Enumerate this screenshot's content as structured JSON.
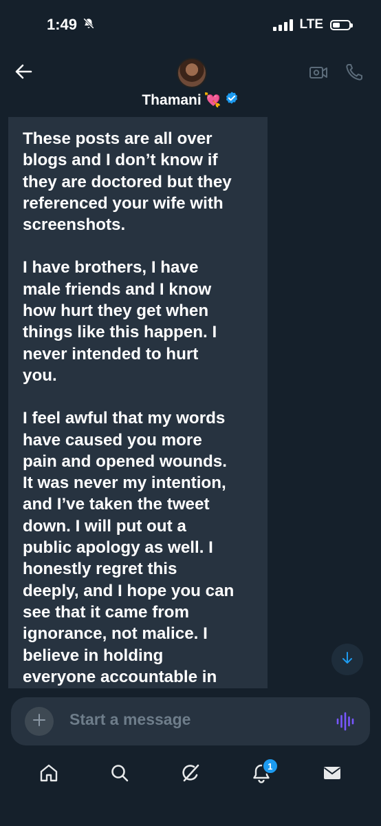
{
  "status_bar": {
    "time": "1:49",
    "network": "LTE",
    "icons": [
      "bell-slash-icon",
      "signal-icon",
      "battery-icon"
    ]
  },
  "header": {
    "contact_name": "Thamani",
    "name_emoji": "💘",
    "verified": true,
    "icons": [
      "back-arrow-icon",
      "video-call-icon",
      "phone-icon"
    ]
  },
  "message": {
    "paragraphs": [
      "These posts are all over\nblogs and I don’t know if\nthey are doctored but they\nreferenced your wife with\nscreenshots.",
      "I have brothers, I have\nmale friends and I know\nhow hurt they get when\nthings like this happen. I\nnever intended to hurt\nyou.",
      "I feel awful that my words\nhave caused you more\npain and opened wounds.\nIt was never my intention,\nand I’ve taken the tweet\ndown. I will put out a\npublic apology as well. I\nhonestly regret this\ndeeply, and I hope you can\nsee that it came from\nignorance, not malice. I\nbelieve in holding\neveryone accountable in"
    ]
  },
  "composer": {
    "placeholder": "Start a message"
  },
  "bottom_nav": {
    "items": [
      "home-icon",
      "search-icon",
      "grok-icon",
      "notifications-icon",
      "messages-icon"
    ],
    "notification_count": "1"
  },
  "colors": {
    "background": "#15202b",
    "bubble": "#273340",
    "accent": "#1d9bf0",
    "voice": "#7856ff"
  }
}
